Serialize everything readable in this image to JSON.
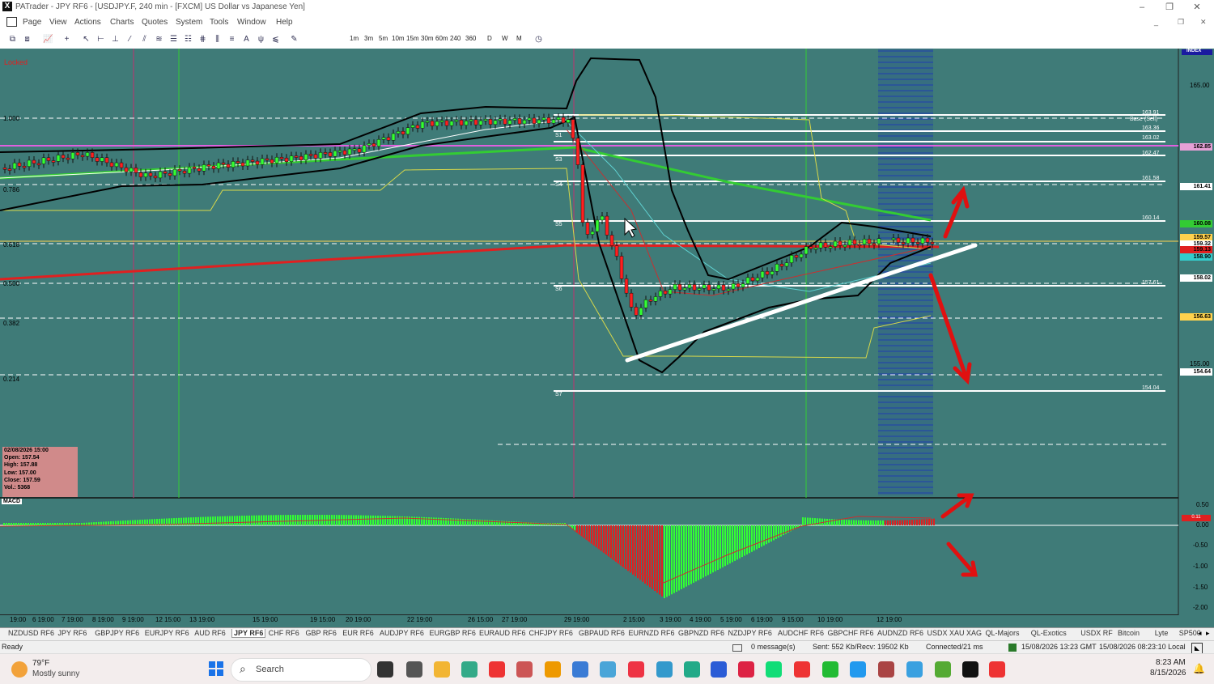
{
  "window": {
    "title": "PATrader - JPY RF6 - [USDJPY.F, 240 min - [FXCM] US Dollar vs Japanese Yen]",
    "app_icon": "X"
  },
  "menu": [
    "Page",
    "View",
    "Actions",
    "Charts",
    "Quotes",
    "System",
    "Tools",
    "Window",
    "Help"
  ],
  "timeframes": [
    "1m",
    "3m",
    "5m",
    "10m",
    "15m",
    "30m",
    "60m",
    "240",
    "360",
    "D",
    "W",
    "M"
  ],
  "chart": {
    "locked_label": "Locked",
    "index_label": "INDEX",
    "price_ticks": [
      "165.00",
      "155.00"
    ],
    "price_badges": [
      {
        "text": "162.85",
        "color": "#e6a0d6"
      },
      {
        "text": "161.41",
        "color": "#ffffff"
      },
      {
        "text": "160.08",
        "color": "#33cc33"
      },
      {
        "text": "159.57",
        "color": "#ffd24d"
      },
      {
        "text": "159.32",
        "color": "#ffffff"
      },
      {
        "text": "159.13",
        "color": "#e02020"
      },
      {
        "text": "158.90",
        "color": "#33cccc"
      },
      {
        "text": "158.02",
        "color": "#ffffff"
      },
      {
        "text": "156.63",
        "color": "#ffd24d"
      },
      {
        "text": "154.64",
        "color": "#ffffff"
      }
    ],
    "fib_labels": [
      "1.000",
      "0.786",
      "0.618",
      "0.500",
      "0.382",
      "0.214"
    ],
    "level_labels": [
      "S1",
      "S3",
      "S4",
      "S5",
      "S6",
      "S7"
    ],
    "level_values": [
      "163.91",
      "Base (Sell)",
      "163.36",
      "163.02",
      "162.47",
      "161.58",
      "160.14",
      "157.61",
      "154.04"
    ],
    "ohlc": {
      "date": "02/08/2026 15:00",
      "open": "Open: 157.54",
      "high": "High: 157.88",
      "low": "Low: 157.00",
      "close": "Close: 157.59",
      "vol": "Vol.: 5368"
    },
    "macd_label": "MACD",
    "macd_ticks": [
      "0.50",
      "0.00",
      "-0.50",
      "-1.00",
      "-1.50",
      "-2.00"
    ],
    "macd_badge": "0.11",
    "time_labels": [
      "19:00",
      "6 19:00",
      "7 19:00",
      "8 19:00",
      "9 19:00",
      "12 15:00",
      "13 19:00",
      "15 19:00",
      "19 15:00",
      "20 19:00",
      "22 19:00",
      "26 15:00",
      "27 19:00",
      "29 19:00",
      "2 15:00",
      "3 19:00",
      "4 19:00",
      "5 19:00",
      "6 19:00",
      "9 15:00",
      "10 19:00",
      "12 19:00"
    ]
  },
  "symbol_tabs": [
    "NZDUSD RF6",
    "JPY RF6",
    "GBPJPY RF6",
    "EURJPY RF6",
    "AUD RF6",
    "JPY RF6",
    "CHF RF6",
    "GBP RF6",
    "EUR RF6",
    "AUDJPY RF6",
    "EURGBP RF6",
    "EURAUD RF6",
    "CHFJPY RF6",
    "GBPAUD RF6",
    "EURNZD RF6",
    "GBPNZD RF6",
    "NZDJPY RF6",
    "AUDCHF RF6",
    "GBPCHF RF6",
    "AUDNZD RF6",
    "USDX XAU XAG",
    "QL-Majors",
    "QL-Exotics",
    "USDX RF",
    "Bitcoin",
    "Lyte",
    "SP500"
  ],
  "status": {
    "ready": "Ready",
    "messages": "0 message(s)",
    "traffic": "Sent: 552 Kb/Recv: 19502 Kb",
    "connection": "Connected/21 ms",
    "gmt": "15/08/2026 13:23 GMT",
    "local": "15/08/2026 08:23:10 Local"
  },
  "taskbar": {
    "weather_temp": "79°F",
    "weather_desc": "Mostly sunny",
    "search_placeholder": "Search",
    "time": "8:23 AM",
    "date": "8/15/2026"
  }
}
